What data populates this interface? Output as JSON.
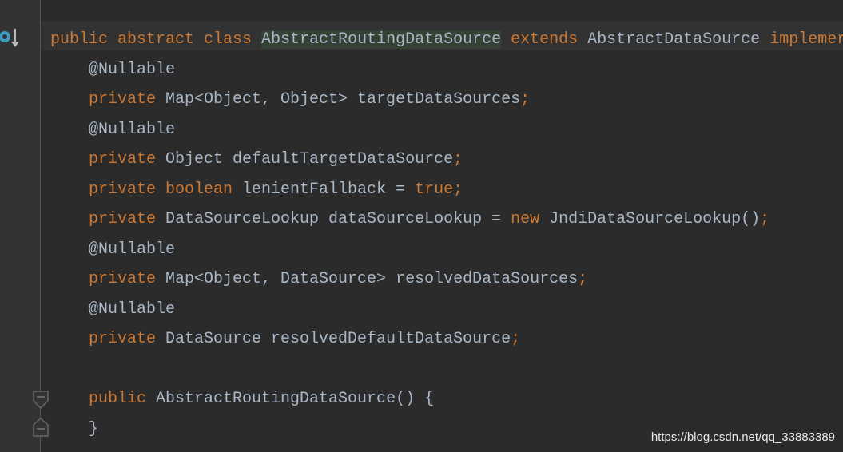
{
  "editor": {
    "lines": [
      {
        "t": [
          [
            "kw",
            "public abstract class "
          ],
          [
            "hl",
            "AbstractRoutingDataSource"
          ],
          [
            "kw",
            " extends "
          ],
          [
            "p",
            "AbstractDataSource "
          ],
          [
            "kw",
            "implemer"
          ]
        ]
      },
      {
        "i": 1,
        "t": [
          [
            "ann",
            "@Nullable"
          ]
        ]
      },
      {
        "i": 1,
        "t": [
          [
            "kw",
            "private "
          ],
          [
            "p",
            "Map<Object, Object> targetDataSources"
          ],
          [
            "kw",
            ";"
          ]
        ]
      },
      {
        "i": 1,
        "t": [
          [
            "ann",
            "@Nullable"
          ]
        ]
      },
      {
        "i": 1,
        "t": [
          [
            "kw",
            "private "
          ],
          [
            "p",
            "Object defaultTargetDataSource"
          ],
          [
            "kw",
            ";"
          ]
        ]
      },
      {
        "i": 1,
        "t": [
          [
            "kw",
            "private boolean "
          ],
          [
            "p",
            "lenientFallback = "
          ],
          [
            "kw",
            "true;"
          ]
        ]
      },
      {
        "i": 1,
        "t": [
          [
            "kw",
            "private "
          ],
          [
            "p",
            "DataSourceLookup dataSourceLookup = "
          ],
          [
            "kw",
            "new "
          ],
          [
            "p",
            "JndiDataSourceLookup()"
          ],
          [
            "kw",
            ";"
          ]
        ]
      },
      {
        "i": 1,
        "t": [
          [
            "ann",
            "@Nullable"
          ]
        ]
      },
      {
        "i": 1,
        "t": [
          [
            "kw",
            "private "
          ],
          [
            "p",
            "Map<Object, DataSource> resolvedDataSources"
          ],
          [
            "kw",
            ";"
          ]
        ]
      },
      {
        "i": 1,
        "t": [
          [
            "ann",
            "@Nullable"
          ]
        ]
      },
      {
        "i": 1,
        "t": [
          [
            "kw",
            "private "
          ],
          [
            "p",
            "DataSource resolvedDefaultDataSource"
          ],
          [
            "kw",
            ";"
          ]
        ]
      },
      {
        "t": []
      },
      {
        "i": 1,
        "t": [
          [
            "kw",
            "public "
          ],
          [
            "p",
            "AbstractRoutingDataSource() {"
          ]
        ]
      },
      {
        "i": 1,
        "t": [
          [
            "p",
            "}"
          ]
        ]
      }
    ]
  },
  "gutter": {
    "implements_icon": "implemented-override-icon",
    "fold_icons": [
      "fold-start-icon",
      "fold-end-icon"
    ]
  },
  "watermark": "https://blog.csdn.net/qq_33883389"
}
